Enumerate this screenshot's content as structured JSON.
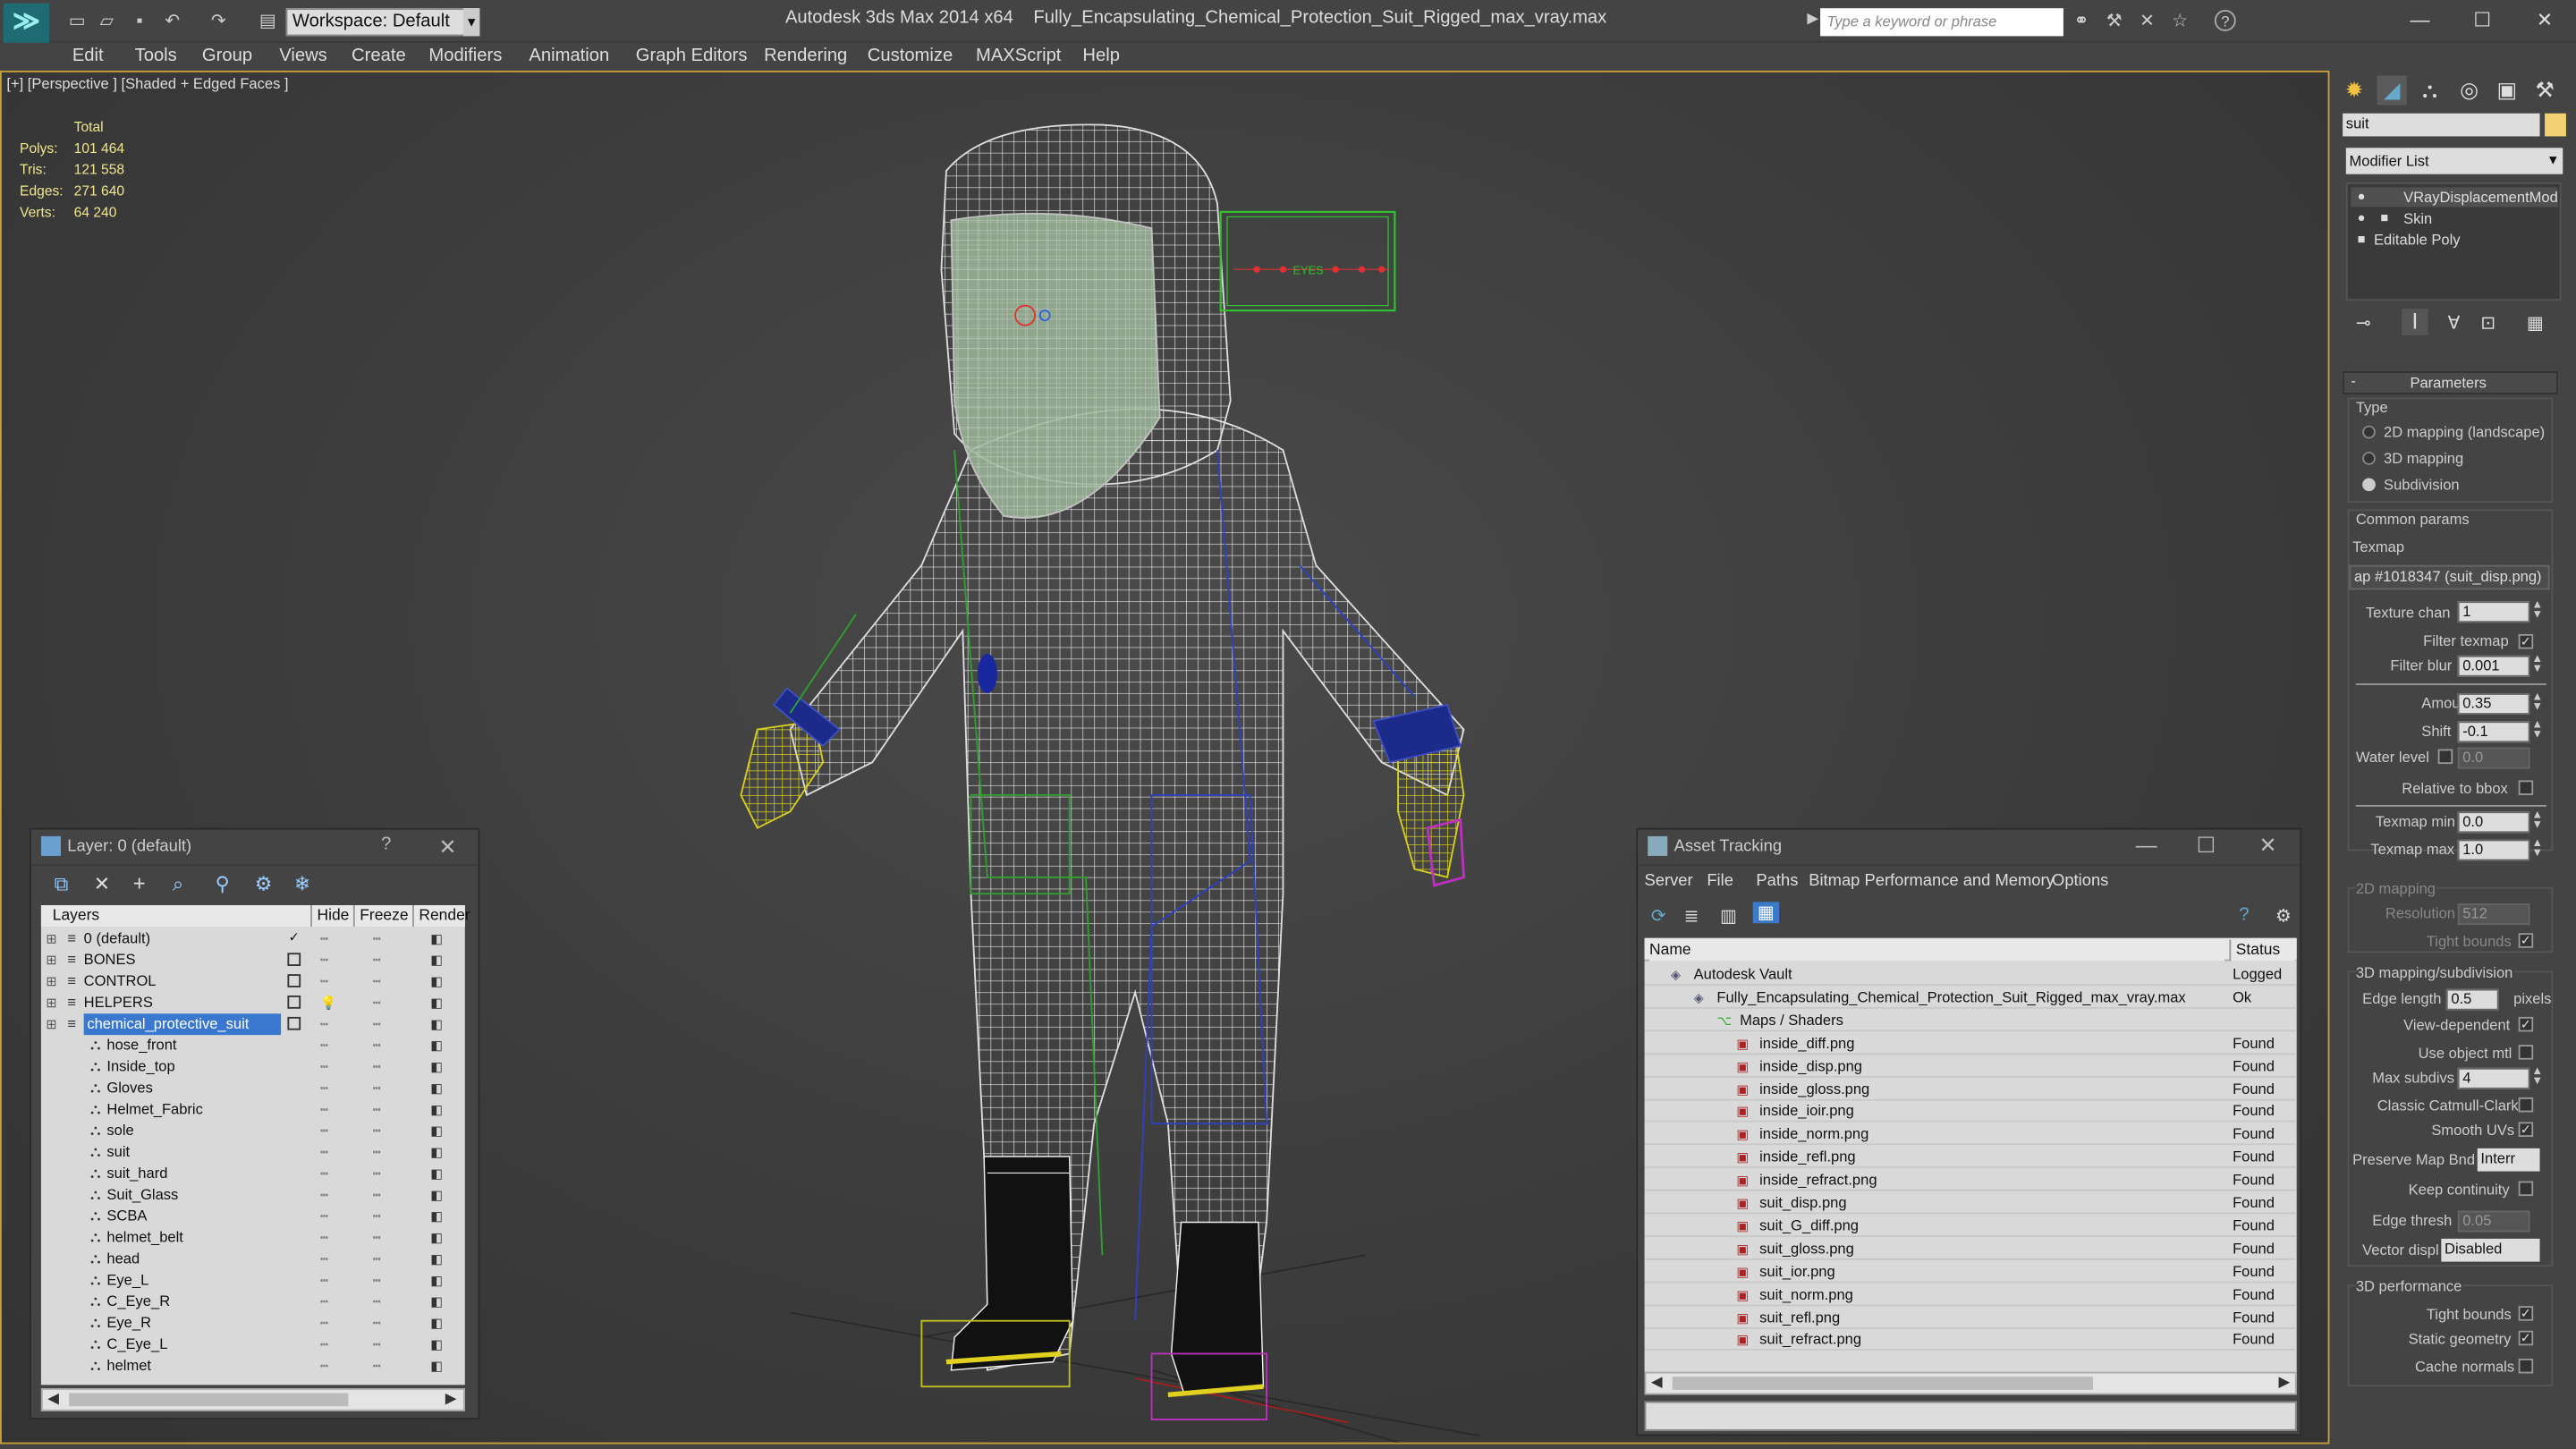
{
  "app": {
    "title": "Autodesk 3ds Max  2014 x64",
    "file": "Fully_Encapsulating_Chemical_Protection_Suit_Rigged_max_vray.max",
    "workspace": "Workspace: Default",
    "search_placeholder": "Type a keyword or phrase"
  },
  "menu": [
    "Edit",
    "Tools",
    "Group",
    "Views",
    "Create",
    "Modifiers",
    "Animation",
    "Graph Editors",
    "Rendering",
    "Customize",
    "MAXScript",
    "Help"
  ],
  "viewport": {
    "label": "[+] [Perspective ] [Shaded + Edged Faces ]",
    "stats_header": "Total",
    "stats": [
      {
        "label": "Polys:",
        "value": "101 464"
      },
      {
        "label": "Tris:",
        "value": "121 558"
      },
      {
        "label": "Edges:",
        "value": "271 640"
      },
      {
        "label": "Verts:",
        "value": "64 240"
      }
    ],
    "eyes_label": "EYES"
  },
  "command_panel": {
    "object_name": "suit",
    "modifier_list": "Modifier List",
    "stack": [
      "VRayDisplacementMod",
      "Skin",
      "Editable Poly"
    ],
    "rollout_title": "Parameters",
    "type_header": "Type",
    "type_options": [
      {
        "label": "2D mapping (landscape)",
        "selected": false
      },
      {
        "label": "3D mapping",
        "selected": false
      },
      {
        "label": "Subdivision",
        "selected": true
      }
    ],
    "common_header": "Common params",
    "texmap_label": "Texmap",
    "texmap_value": "ap #1018347 (suit_disp.png)",
    "texture_chan_label": "Texture chan",
    "texture_chan": "1",
    "filter_texmap_label": "Filter texmap",
    "filter_blur_label": "Filter blur",
    "filter_blur": "0.001",
    "amount_label": "Amount",
    "amount": "0.35",
    "shift_label": "Shift",
    "shift": "-0.1",
    "water_level_label": "Water level",
    "water_level": "0.0",
    "relative_bbox_label": "Relative to bbox",
    "texmap_min_label": "Texmap min",
    "texmap_min": "0.0",
    "texmap_max_label": "Texmap max",
    "texmap_max": "1.0",
    "mapping2d_header": "2D mapping",
    "resolution_label": "Resolution",
    "resolution": "512",
    "tight_bounds_label": "Tight bounds",
    "subdiv_header": "3D mapping/subdivision",
    "edge_length_label": "Edge length",
    "edge_length": "0.5",
    "edge_length_unit": "pixels",
    "view_dependent_label": "View-dependent",
    "use_object_mtl_label": "Use object mtl",
    "max_subdivs_label": "Max subdivs",
    "max_subdivs": "4",
    "catmull_label": "Classic Catmull-Clark",
    "smooth_uvs_label": "Smooth UVs",
    "preserve_label": "Preserve Map Bnd",
    "preserve_value": "Interr",
    "keep_continuity_label": "Keep continuity",
    "edge_thresh_label": "Edge thresh",
    "edge_thresh": "0.05",
    "vector_displ_label": "Vector displ",
    "vector_displ_value": "Disabled",
    "perf_header": "3D performance",
    "tight_bounds2_label": "Tight bounds",
    "static_geometry_label": "Static geometry",
    "cache_normals_label": "Cache normals"
  },
  "layer_panel": {
    "title": "Layer: 0 (default)",
    "help": "?",
    "columns": [
      "Layers",
      "Hide",
      "Freeze",
      "Render"
    ],
    "layers": [
      {
        "name": "0 (default)",
        "level": 0,
        "type": "layer",
        "check": true
      },
      {
        "name": "BONES",
        "level": 0,
        "type": "layer"
      },
      {
        "name": "CONTROL",
        "level": 0,
        "type": "layer"
      },
      {
        "name": "HELPERS",
        "level": 0,
        "type": "layer"
      },
      {
        "name": "chemical_protective_suit",
        "level": 0,
        "type": "layer",
        "selected": true
      },
      {
        "name": "hose_front",
        "level": 1,
        "type": "obj"
      },
      {
        "name": "Inside_top",
        "level": 1,
        "type": "obj"
      },
      {
        "name": "Gloves",
        "level": 1,
        "type": "obj"
      },
      {
        "name": "Helmet_Fabric",
        "level": 1,
        "type": "obj"
      },
      {
        "name": "sole",
        "level": 1,
        "type": "obj"
      },
      {
        "name": "suit",
        "level": 1,
        "type": "obj"
      },
      {
        "name": "suit_hard",
        "level": 1,
        "type": "obj"
      },
      {
        "name": "Suit_Glass",
        "level": 1,
        "type": "obj"
      },
      {
        "name": "SCBA",
        "level": 1,
        "type": "obj"
      },
      {
        "name": "helmet_belt",
        "level": 1,
        "type": "obj"
      },
      {
        "name": "head",
        "level": 1,
        "type": "obj"
      },
      {
        "name": "Eye_L",
        "level": 1,
        "type": "obj"
      },
      {
        "name": "C_Eye_R",
        "level": 1,
        "type": "obj"
      },
      {
        "name": "Eye_R",
        "level": 1,
        "type": "obj"
      },
      {
        "name": "C_Eye_L",
        "level": 1,
        "type": "obj"
      },
      {
        "name": "helmet",
        "level": 1,
        "type": "obj"
      }
    ]
  },
  "asset_panel": {
    "title": "Asset Tracking",
    "menu": [
      "Server",
      "File",
      "Paths",
      "Bitmap Performance and Memory",
      "Options"
    ],
    "columns": [
      "Name",
      "Status"
    ],
    "rows": [
      {
        "name": "Autodesk Vault",
        "status": "Logged",
        "level": 0
      },
      {
        "name": "Fully_Encapsulating_Chemical_Protection_Suit_Rigged_max_vray.max",
        "status": "Ok",
        "level": 1
      },
      {
        "name": "Maps / Shaders",
        "status": "",
        "level": 2
      },
      {
        "name": "inside_diff.png",
        "status": "Found",
        "level": 3
      },
      {
        "name": "inside_disp.png",
        "status": "Found",
        "level": 3
      },
      {
        "name": "inside_gloss.png",
        "status": "Found",
        "level": 3
      },
      {
        "name": "inside_ioir.png",
        "status": "Found",
        "level": 3
      },
      {
        "name": "inside_norm.png",
        "status": "Found",
        "level": 3
      },
      {
        "name": "inside_refl.png",
        "status": "Found",
        "level": 3
      },
      {
        "name": "inside_refract.png",
        "status": "Found",
        "level": 3
      },
      {
        "name": "suit_disp.png",
        "status": "Found",
        "level": 3
      },
      {
        "name": "suit_G_diff.png",
        "status": "Found",
        "level": 3
      },
      {
        "name": "suit_gloss.png",
        "status": "Found",
        "level": 3
      },
      {
        "name": "suit_ior.png",
        "status": "Found",
        "level": 3
      },
      {
        "name": "suit_norm.png",
        "status": "Found",
        "level": 3
      },
      {
        "name": "suit_refl.png",
        "status": "Found",
        "level": 3
      },
      {
        "name": "suit_refract.png",
        "status": "Found",
        "level": 3
      }
    ]
  }
}
